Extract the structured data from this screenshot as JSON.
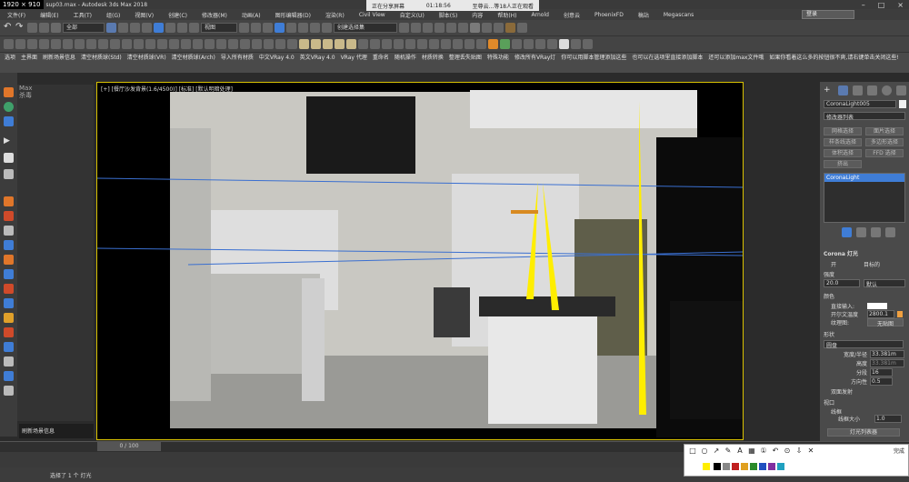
{
  "titlebar": {
    "resolution": "1920 × 910",
    "title": "sup03.max - Autodesk 3ds Max 2018"
  },
  "share": {
    "status": "正在分享屏幕",
    "time": "01:18:56",
    "viewers": "至尊云...等18人正在观看"
  },
  "menu": [
    "文件(F)",
    "编辑(E)",
    "工具(T)",
    "组(G)",
    "视图(V)",
    "创建(C)",
    "修改器(M)",
    "动画(A)",
    "图形编辑器(D)",
    "渲染(R)",
    "Civil View",
    "自定义(U)",
    "脚本(S)",
    "内容",
    "帮助(H)",
    "Arnold",
    "创意云",
    "PhoenixFD",
    "稿站",
    "Megascans"
  ],
  "login_label": "登录",
  "toolbar": {
    "select_filter": "全部",
    "view_dropdown": "视图",
    "selection_set": "创建选择集"
  },
  "command_buttons": [
    "选项",
    "主界面",
    "刷新场景信息",
    "清空材质球(Std)",
    "清空材质球(VR)",
    "清空材质球(Arch)",
    "导入所有材质",
    "中文VRay 4.0",
    "英文VRay 4.0",
    "VRay 代理",
    "重命名",
    "随机操作",
    "材质转换",
    "整理丢失贴图",
    "特殊功能",
    "修改所有VRay灯",
    "你可以用脚本管理添加这些",
    "也可以在选项里直接添加脚本",
    "还可以添加max文件哦"
  ],
  "command_help": "如果你看着这么多的按钮很不爽,请右键单击关闭这些!",
  "left_panel": {
    "max_label": "Max",
    "sub_label": "杀毒",
    "chat_text": "刷新场景信息"
  },
  "viewport": {
    "label": "[+] [餐厅沙发背景(1.6/4500)] [标准] [默认明暗处理]"
  },
  "right_panel": {
    "object_name": "CoronaLight005",
    "modifier_list": "修改器列表",
    "buttons": [
      "网格选择",
      "面片选择",
      "样条线选择",
      "多边形选择",
      "体积选择",
      "FFD 选择",
      "挤出"
    ],
    "stack_item": "CoronaLight",
    "rollout_title": "Corona 灯光",
    "on_label": "开",
    "targeted_label": "目标的",
    "intensity_label": "强度",
    "intensity_value": "20.0",
    "intensity_unit": "默认",
    "color_label": "颜色",
    "direct_input": "直接输入:",
    "kelvin_label": "开尔文温度",
    "kelvin_value": "2800.1",
    "texmap_label": "纹理图:",
    "texmap_value": "无贴图",
    "shape_label": "形状",
    "shape_value": "圆盘",
    "width_label": "宽度/半径",
    "width_value": "33.381m",
    "height_label": "高度",
    "height_value": "33.381m",
    "segments_label": "分段",
    "segments_value": "16",
    "directionality_label": "方向性",
    "directionality_value": "0.5",
    "twosided_label": "双面发射",
    "viewport_label": "视口",
    "wire_label": "线框",
    "wire_size_label": "线框大小",
    "wire_size_value": "1.0",
    "lister_button": "灯光列表器"
  },
  "timeline": {
    "frame_text": "0 / 100"
  },
  "status": {
    "selection": "选择了 1 个 灯光"
  },
  "snip": {
    "done_label": "完成"
  },
  "colors": {
    "accent": "#d9c200",
    "viewport_border": "#d9c200",
    "light_arrow": "#ffee00",
    "panel_bg": "#4a4a4a"
  }
}
